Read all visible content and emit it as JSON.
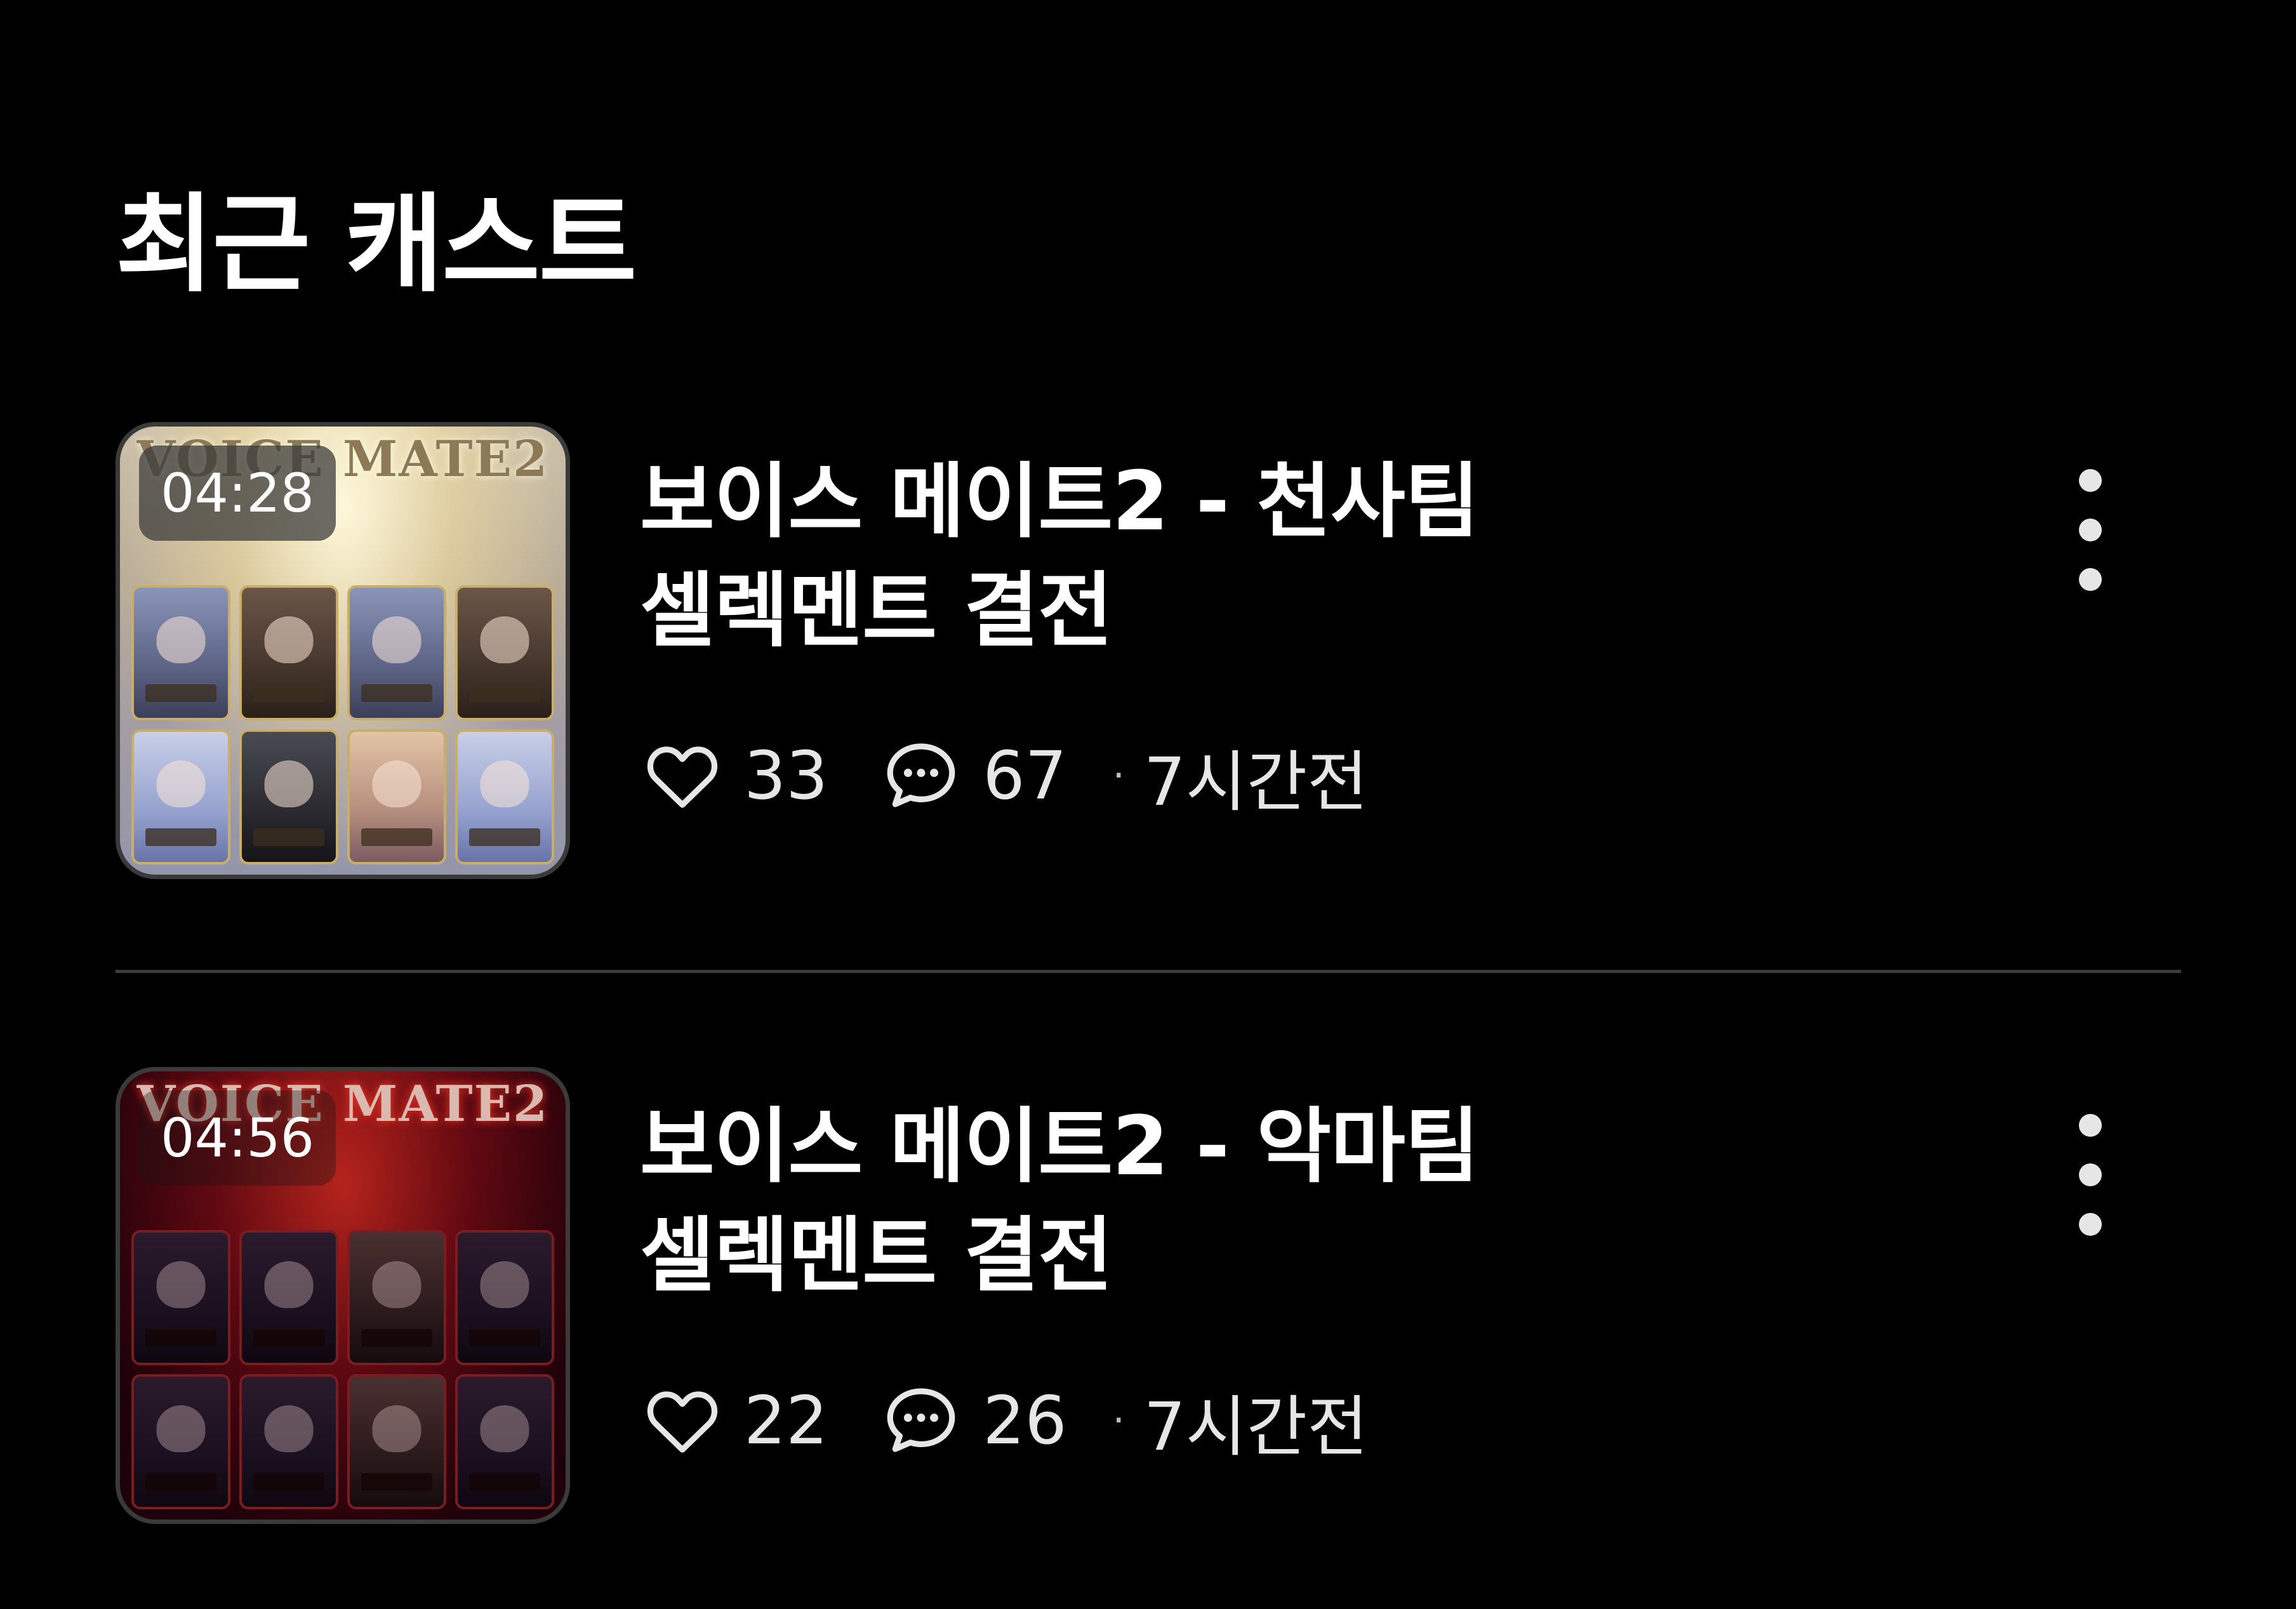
{
  "section": {
    "title": "최근 캐스트"
  },
  "casts": [
    {
      "theme": "angel",
      "duration": "04:28",
      "thumbnail_banner": "VOICE MATE2",
      "title_line1": "보이스 메이트2 - 천사팀",
      "title_line2": "셀렉멘트 결전",
      "likes": "33",
      "comments": "67",
      "time_ago": "7시간전"
    },
    {
      "theme": "devil",
      "duration": "04:56",
      "thumbnail_banner": "VOICE MATE2",
      "title_line1": "보이스 메이트2 - 악마팀",
      "title_line2": "셀렉멘트 결전",
      "likes": "22",
      "comments": "26",
      "time_ago": "7시간전"
    }
  ],
  "separator": "·",
  "icons": {
    "like": "heart-outline-icon",
    "comment": "speech-bubble-ellipsis-icon",
    "more": "vertical-ellipsis-icon"
  },
  "colors": {
    "background": "#000000",
    "text_primary": "#ffffff",
    "text_secondary": "#e6e6e6",
    "divider": "#3c3c3c"
  }
}
